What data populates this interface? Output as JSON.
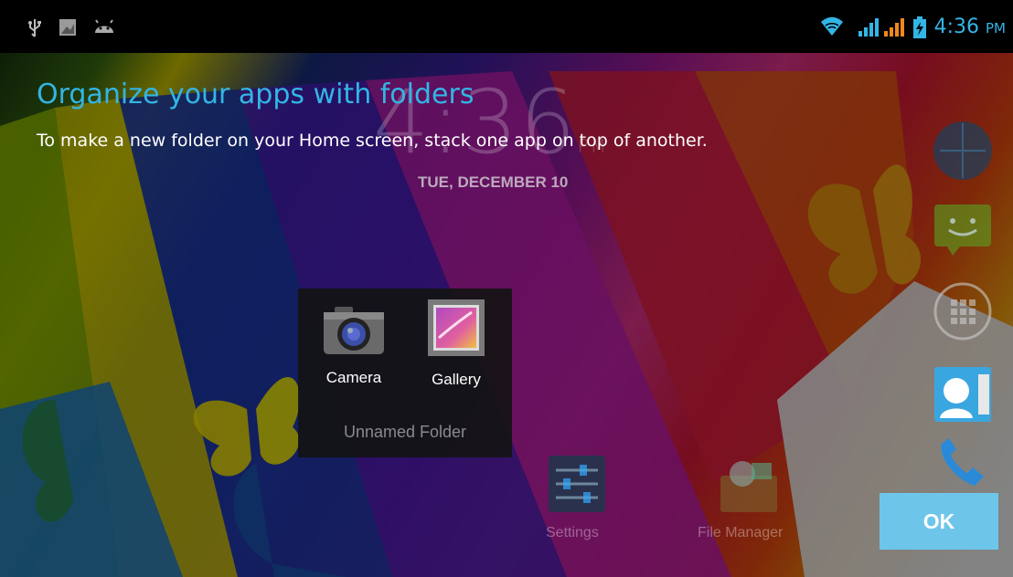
{
  "status_bar": {
    "time": "4:36",
    "ampm": "PM",
    "left_icons": [
      "usb-icon",
      "screenshot-icon",
      "android-debug-icon"
    ],
    "right_icons": [
      "wifi-icon",
      "signal-sim1-icon",
      "signal-sim2-icon",
      "battery-charging-icon"
    ]
  },
  "cling": {
    "title": "Organize your apps with folders",
    "text": "To make a new folder on your Home screen, stack one app on top of another."
  },
  "background_clock": {
    "time": "4:36",
    "ampm": "PM",
    "date": "TUE, DECEMBER 10"
  },
  "folder": {
    "name": "Unnamed Folder",
    "apps": [
      {
        "label": "Camera",
        "icon": "camera-icon"
      },
      {
        "label": "Gallery",
        "icon": "gallery-icon"
      }
    ]
  },
  "home_icons": [
    {
      "label": "Settings",
      "icon": "settings-icon"
    },
    {
      "label": "File Manager",
      "icon": "file-manager-icon"
    }
  ],
  "right_column_icons": [
    "browser-icon",
    "messaging-icon",
    "app-drawer-icon",
    "contacts-icon",
    "phone-icon"
  ],
  "ok_label": "OK",
  "colors": {
    "accent": "#33b5e5",
    "ok_button": "#6dc6ea",
    "folder_bg": "#141414"
  }
}
